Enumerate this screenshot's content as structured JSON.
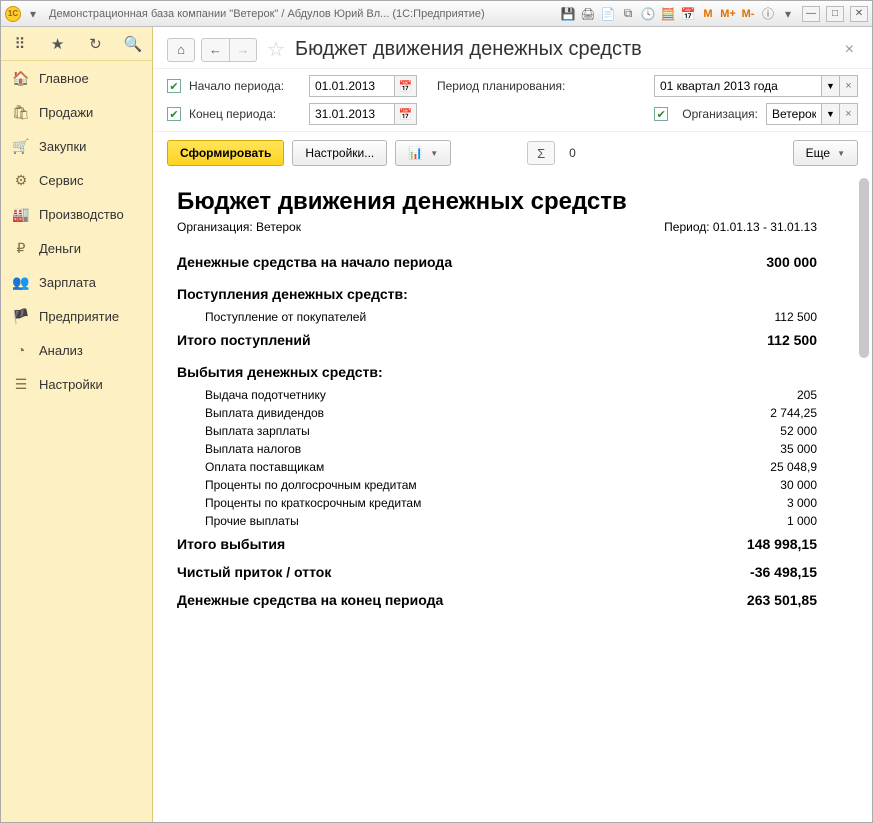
{
  "titlebar": {
    "title": "Демонстрационная база компании \"Ветерок\" / Абдулов Юрий Вл...   (1С:Предприятие)",
    "m1": "M",
    "m2": "M+",
    "m3": "M-"
  },
  "sidebar": {
    "items": [
      {
        "icon": "🏠",
        "label": "Главное"
      },
      {
        "icon": "🛍",
        "label": "Продажи"
      },
      {
        "icon": "🛒",
        "label": "Закупки"
      },
      {
        "icon": "⚙",
        "label": "Сервис"
      },
      {
        "icon": "🏭",
        "label": "Производство"
      },
      {
        "icon": "₽",
        "label": "Деньги"
      },
      {
        "icon": "👥",
        "label": "Зарплата"
      },
      {
        "icon": "🏴",
        "label": "Предприятие"
      },
      {
        "icon": "◔",
        "label": "Анализ"
      },
      {
        "icon": "☰",
        "label": "Настройки"
      }
    ]
  },
  "header": {
    "title": "Бюджет движения денежных средств"
  },
  "params": {
    "start_label": "Начало периода:",
    "start_value": "01.01.2013",
    "end_label": "Конец периода:",
    "end_value": "31.01.2013",
    "plan_label": "Период планирования:",
    "plan_value": "01 квартал 2013 года",
    "org_label": "Организация:",
    "org_value": "Ветерок"
  },
  "toolbar": {
    "form": "Сформировать",
    "settings": "Настройки...",
    "sum_symbol": "Σ",
    "sum_value": "0",
    "more": "Еще"
  },
  "report": {
    "title": "Бюджет движения денежных средств",
    "org_prefix": "Организация: ",
    "org": "Ветерок",
    "period_prefix": "Период: ",
    "period": "01.01.13 - 31.01.13",
    "begin_label": "Денежные средства на начало периода",
    "begin_value": "300 000",
    "inflow_header": "Поступления денежных средств:",
    "inflows": [
      {
        "label": "Поступление от покупателей",
        "value": "112 500"
      }
    ],
    "inflow_total_label": "Итого поступлений",
    "inflow_total_value": "112 500",
    "outflow_header": "Выбытия денежных средств:",
    "outflows": [
      {
        "label": "Выдача подотчетнику",
        "value": "205"
      },
      {
        "label": "Выплата дивидендов",
        "value": "2 744,25"
      },
      {
        "label": "Выплата зарплаты",
        "value": "52 000"
      },
      {
        "label": "Выплата налогов",
        "value": "35 000"
      },
      {
        "label": "Оплата поставщикам",
        "value": "25 048,9"
      },
      {
        "label": "Проценты по долгосрочным кредитам",
        "value": "30 000"
      },
      {
        "label": "Проценты по краткосрочным кредитам",
        "value": "3 000"
      },
      {
        "label": "Прочие выплаты",
        "value": "1 000"
      }
    ],
    "outflow_total_label": "Итого выбытия",
    "outflow_total_value": "148 998,15",
    "net_label": "Чистый приток / отток",
    "net_value": "-36 498,15",
    "end_label": "Денежные средства на конец периода",
    "end_value": "263 501,85"
  }
}
